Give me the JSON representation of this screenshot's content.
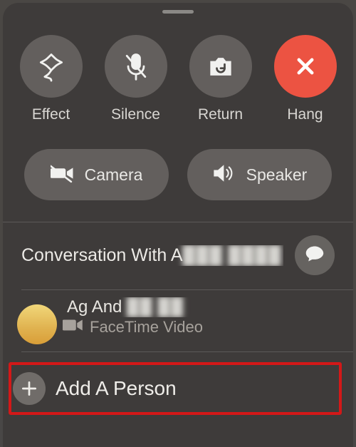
{
  "actions": {
    "effect": {
      "label": "Effect"
    },
    "silence": {
      "label": "Silence"
    },
    "return": {
      "label": "Return"
    },
    "hangup": {
      "label": "Hang"
    }
  },
  "toggles": {
    "camera": {
      "label": "Camera"
    },
    "speaker": {
      "label": "Speaker"
    }
  },
  "conversation": {
    "prefix": "Conversation With A",
    "obscured_tail": "███ ████"
  },
  "participant": {
    "name_visible": "Ag And",
    "name_obscured": "██ ██",
    "subtext": "FaceTime Video"
  },
  "add_person": {
    "label": "Add A Person"
  },
  "colors": {
    "hangup_red": "#ec5342",
    "highlight_box": "#d31818"
  }
}
